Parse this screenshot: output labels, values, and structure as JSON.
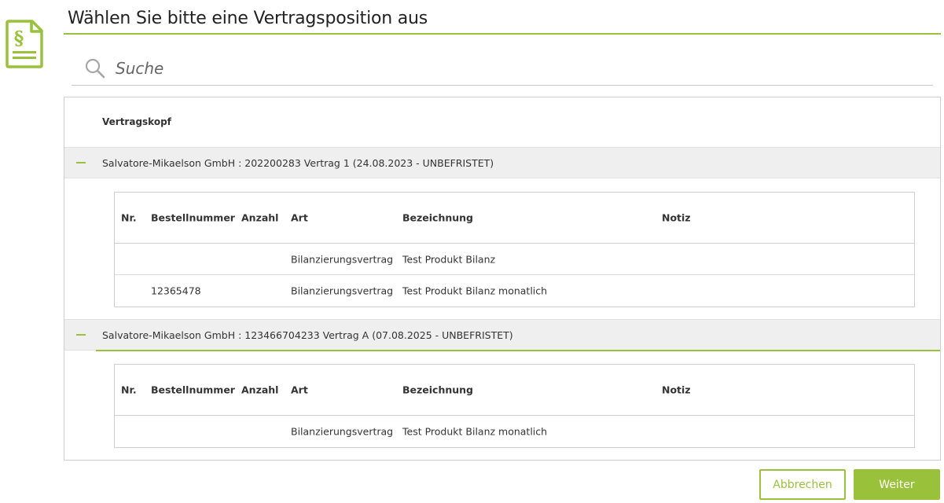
{
  "page": {
    "title": "Wählen Sie bitte eine Vertragsposition aus",
    "accent_color": "#99c23a",
    "icon": "document-paragraph-icon"
  },
  "search": {
    "placeholder": "Suche",
    "icon": "search-icon"
  },
  "list": {
    "header": "Vertragskopf",
    "columns": [
      "Nr.",
      "Bestellnummer",
      "Anzahl",
      "Art",
      "Bezeichnung",
      "Notiz"
    ],
    "groups": [
      {
        "label": "Salvatore-Mikaelson GmbH : 202200283 Vertrag 1 (24.08.2023 - UNBEFRISTET)",
        "expanded": true,
        "rows": [
          {
            "nr": "",
            "bestellnummer": "",
            "anzahl": "",
            "art": "Bilanzierungsvertrag",
            "bezeichnung": "Test Produkt Bilanz",
            "notiz": ""
          },
          {
            "nr": "",
            "bestellnummer": "12365478",
            "anzahl": "",
            "art": "Bilanzierungsvertrag",
            "bezeichnung": "Test Produkt Bilanz monatlich",
            "notiz": ""
          }
        ]
      },
      {
        "label": "Salvatore-Mikaelson GmbH : 123466704233 Vertrag A (07.08.2025 - UNBEFRISTET)",
        "expanded": true,
        "rows": [
          {
            "nr": "",
            "bestellnummer": "",
            "anzahl": "",
            "art": "Bilanzierungsvertrag",
            "bezeichnung": "Test Produkt Bilanz monatlich",
            "notiz": ""
          }
        ]
      }
    ]
  },
  "buttons": {
    "cancel": "Abbrechen",
    "next": "Weiter"
  }
}
